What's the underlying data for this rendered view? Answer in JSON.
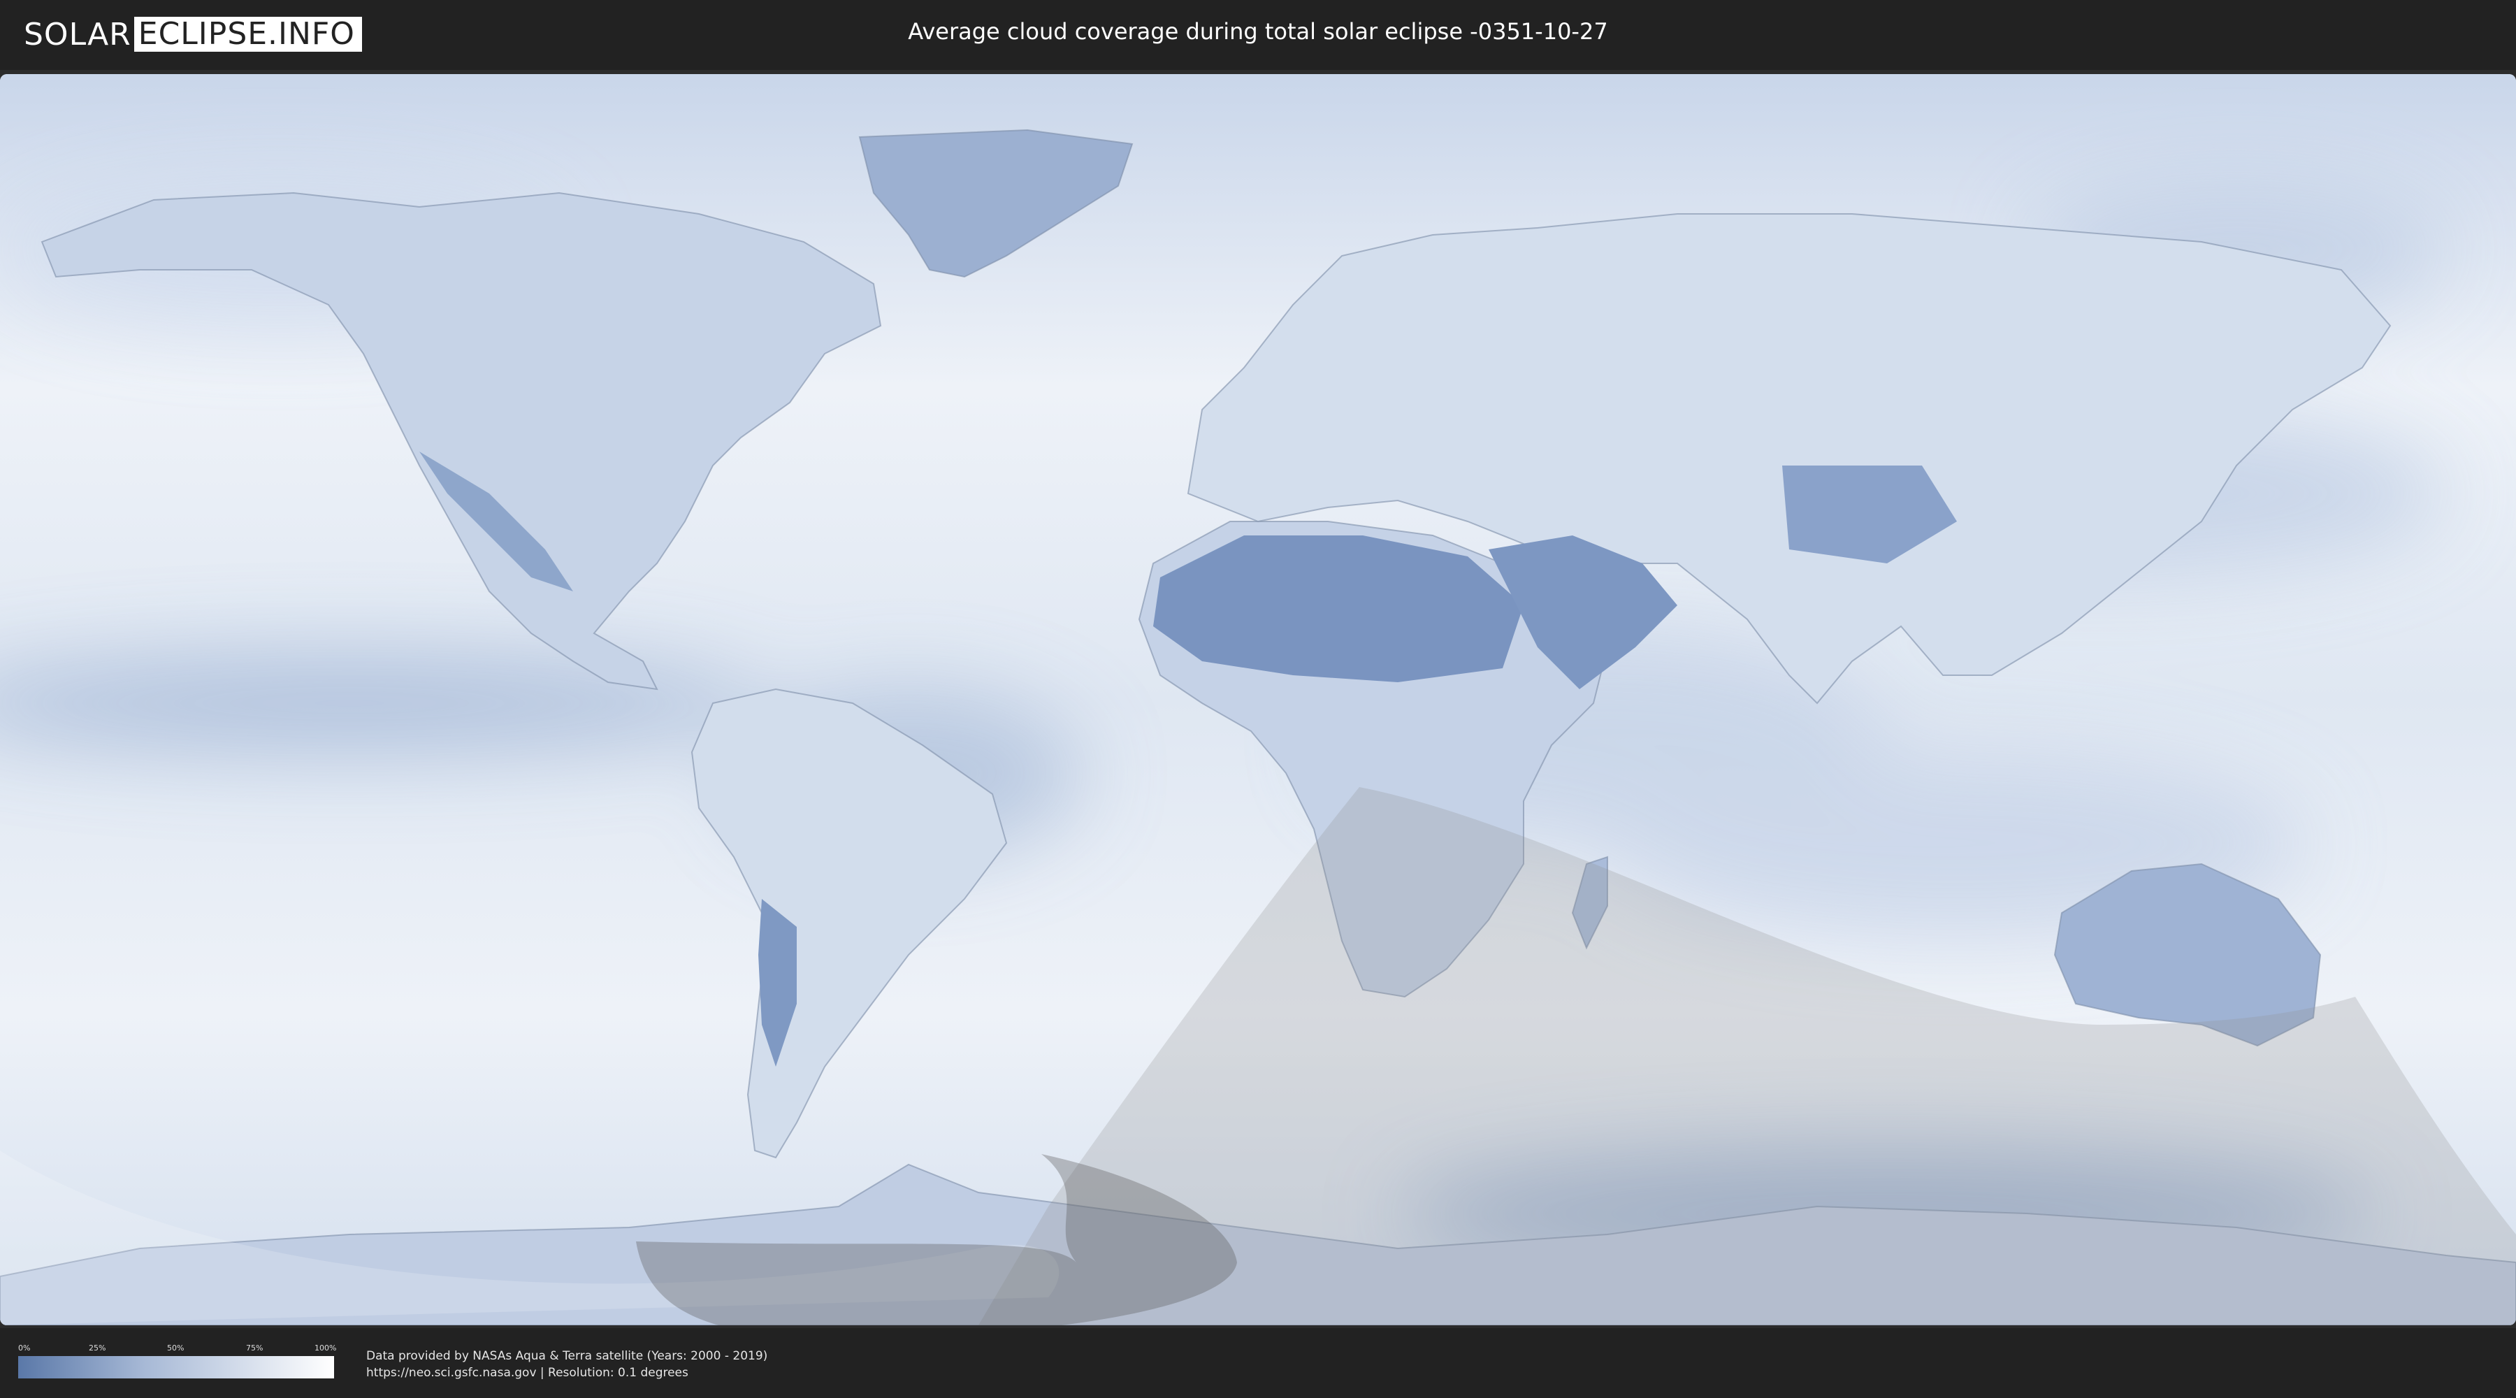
{
  "header": {
    "logo_part1": "SOLAR",
    "logo_part2": "ECLIPSE.INFO",
    "title": "Average cloud coverage during total solar eclipse -0351-10-27"
  },
  "map": {
    "colors": {
      "cloud_low": "#5a78a8",
      "cloud_mid": "#a7b9d6",
      "cloud_high": "#ffffff",
      "eclipse_shade": "#999999"
    }
  },
  "legend": {
    "ticks": [
      "0%",
      "25%",
      "50%",
      "75%",
      "100%"
    ],
    "tick_values": [
      0,
      0.25,
      0.5,
      0.75,
      1
    ]
  },
  "footer": {
    "source_line1": "Data provided by NASAs Aqua & Terra satellite (Years: 2000 - 2019)",
    "source_line2": "https://neo.sci.gsfc.nasa.gov | Resolution: 0.1 degrees"
  }
}
